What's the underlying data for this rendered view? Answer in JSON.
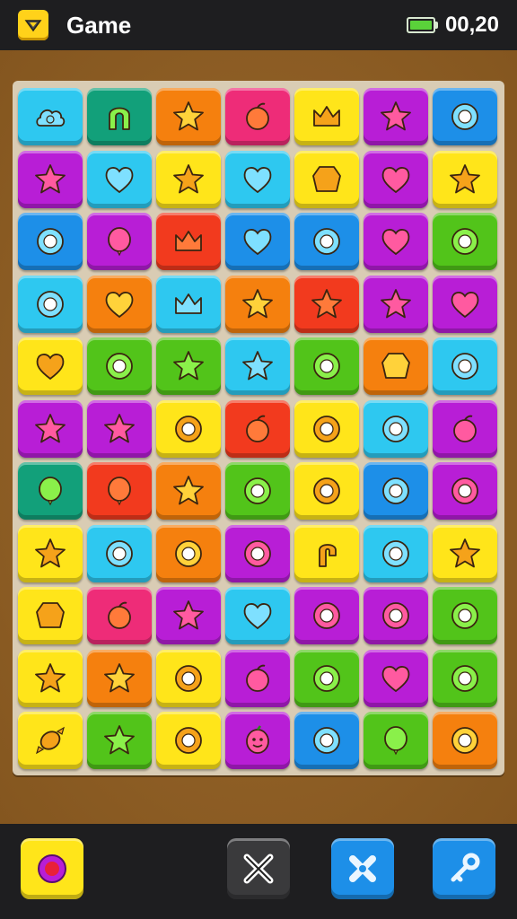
{
  "header": {
    "title": "Game",
    "time": "00,20",
    "battery_level": 1.0,
    "menu_icon": "chevron-down-icon"
  },
  "colors": {
    "cyan": "#2ec8f0",
    "teal": "#12a07a",
    "orange": "#f5800e",
    "red": "#f23a1e",
    "yellow": "#ffe51a",
    "purple": "#b81ed6",
    "blue": "#1d8fe8",
    "green": "#52c41a",
    "pink": "#ee2c78"
  },
  "board": {
    "rows": [
      [
        [
          "cyan",
          "cloud"
        ],
        [
          "teal",
          "arch"
        ],
        [
          "orange",
          "star"
        ],
        [
          "pink",
          "fruit"
        ],
        [
          "yellow",
          "crown"
        ],
        [
          "purple",
          "star"
        ],
        [
          "blue",
          "ring"
        ]
      ],
      [
        [
          "purple",
          "star"
        ],
        [
          "cyan",
          "heart"
        ],
        [
          "yellow",
          "star"
        ],
        [
          "cyan",
          "heart"
        ],
        [
          "yellow",
          "gem"
        ],
        [
          "purple",
          "heart"
        ],
        [
          "yellow",
          "star"
        ]
      ],
      [
        [
          "blue",
          "ring"
        ],
        [
          "purple",
          "balloon"
        ],
        [
          "red",
          "crown"
        ],
        [
          "blue",
          "heart"
        ],
        [
          "blue",
          "ring"
        ],
        [
          "purple",
          "heart"
        ],
        [
          "green",
          "ring"
        ]
      ],
      [
        [
          "cyan",
          "ring"
        ],
        [
          "orange",
          "heart"
        ],
        [
          "cyan",
          "crown"
        ],
        [
          "orange",
          "star"
        ],
        [
          "red",
          "star"
        ],
        [
          "purple",
          "star"
        ],
        [
          "purple",
          "heart"
        ]
      ],
      [
        [
          "yellow",
          "heart"
        ],
        [
          "green",
          "ring"
        ],
        [
          "green",
          "star"
        ],
        [
          "cyan",
          "star"
        ],
        [
          "green",
          "ring"
        ],
        [
          "orange",
          "gem"
        ],
        [
          "cyan",
          "ring"
        ]
      ],
      [
        [
          "purple",
          "star"
        ],
        [
          "purple",
          "star"
        ],
        [
          "yellow",
          "ring"
        ],
        [
          "red",
          "fruit"
        ],
        [
          "yellow",
          "ring"
        ],
        [
          "cyan",
          "ring"
        ],
        [
          "purple",
          "fruit"
        ]
      ],
      [
        [
          "teal",
          "balloon"
        ],
        [
          "red",
          "balloon"
        ],
        [
          "orange",
          "star"
        ],
        [
          "green",
          "ring"
        ],
        [
          "yellow",
          "ring"
        ],
        [
          "blue",
          "ring"
        ],
        [
          "purple",
          "ring"
        ]
      ],
      [
        [
          "yellow",
          "star"
        ],
        [
          "cyan",
          "ring"
        ],
        [
          "orange",
          "ring"
        ],
        [
          "purple",
          "ring"
        ],
        [
          "yellow",
          "hook"
        ],
        [
          "cyan",
          "ring"
        ],
        [
          "yellow",
          "star"
        ]
      ],
      [
        [
          "yellow",
          "gem"
        ],
        [
          "pink",
          "fruit"
        ],
        [
          "purple",
          "star"
        ],
        [
          "cyan",
          "heart"
        ],
        [
          "purple",
          "ring"
        ],
        [
          "purple",
          "ring"
        ],
        [
          "green",
          "ring"
        ]
      ],
      [
        [
          "yellow",
          "star"
        ],
        [
          "orange",
          "star"
        ],
        [
          "yellow",
          "ring"
        ],
        [
          "purple",
          "fruit"
        ],
        [
          "green",
          "ring"
        ],
        [
          "purple",
          "heart"
        ],
        [
          "green",
          "ring"
        ]
      ],
      [
        [
          "yellow",
          "candy"
        ],
        [
          "green",
          "star"
        ],
        [
          "yellow",
          "ring"
        ],
        [
          "purple",
          "face"
        ],
        [
          "blue",
          "ring"
        ],
        [
          "green",
          "balloon"
        ],
        [
          "orange",
          "ring"
        ]
      ]
    ]
  },
  "toolbar": {
    "buttons": [
      {
        "name": "bomb-booster-button",
        "icon": "target-icon",
        "color": "#ffe51a"
      },
      {
        "name": "shuffle-booster-button",
        "icon": "cross-swap-icon",
        "color": "#3a3a3c"
      },
      {
        "name": "swap-booster-button",
        "icon": "cross-icon",
        "color": "#1d8fe8"
      },
      {
        "name": "hammer-booster-button",
        "icon": "key-icon",
        "color": "#1d8fe8"
      }
    ]
  }
}
